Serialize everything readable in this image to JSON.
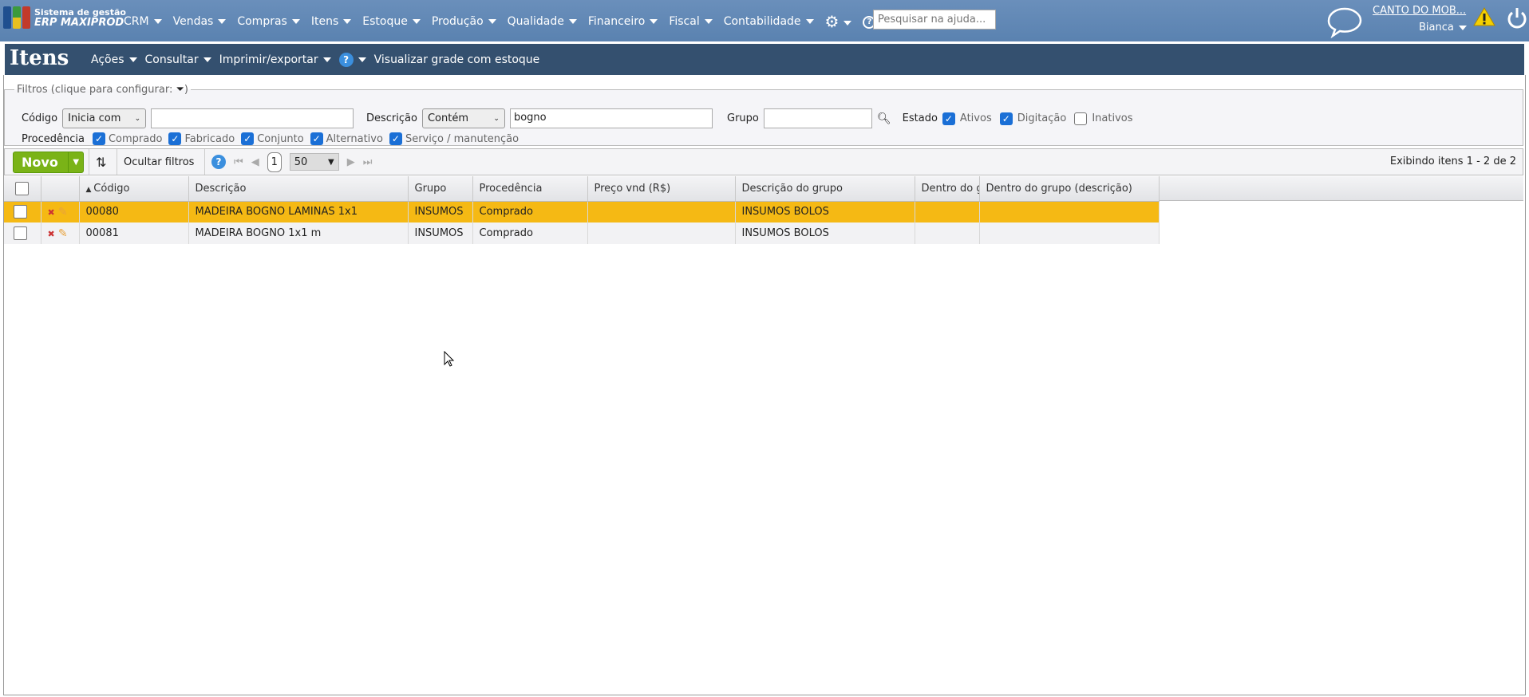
{
  "app": {
    "logo_line1": "Sistema de gestão",
    "logo_line2": "ERP MAXIPROD"
  },
  "nav": {
    "items": [
      "CRM",
      "Vendas",
      "Compras",
      "Itens",
      "Estoque",
      "Produção",
      "Qualidade",
      "Financeiro",
      "Fiscal",
      "Contabilidade"
    ],
    "help_search_placeholder": "Pesquisar na ajuda...",
    "company": "CANTO DO MOB...",
    "user": "Bianca"
  },
  "title": {
    "text": "Itens",
    "menu": [
      "Ações",
      "Consultar",
      "Imprimir/exportar"
    ],
    "grid_link": "Visualizar grade com estoque"
  },
  "filters": {
    "legend": "Filtros (clique para configurar:",
    "legend_close": ")",
    "codigo_label": "Código",
    "codigo_mode": "Inicia com",
    "codigo_value": "",
    "descricao_label": "Descrição",
    "descricao_mode": "Contém",
    "descricao_value": "bogno",
    "grupo_label": "Grupo",
    "grupo_value": "",
    "estado_label": "Estado",
    "estado": [
      {
        "label": "Ativos",
        "checked": true
      },
      {
        "label": "Digitação",
        "checked": true
      },
      {
        "label": "Inativos",
        "checked": false
      }
    ],
    "procedencia_label": "Procedência",
    "procedencia": [
      {
        "label": "Comprado",
        "checked": true
      },
      {
        "label": "Fabricado",
        "checked": true
      },
      {
        "label": "Conjunto",
        "checked": true
      },
      {
        "label": "Alternativo",
        "checked": true
      },
      {
        "label": "Serviço / manutenção",
        "checked": true
      }
    ]
  },
  "toolbar": {
    "new_label": "Novo",
    "hide_filters": "Ocultar filtros",
    "page": "1",
    "page_size": "50",
    "showing": "Exibindo itens 1 - 2 de 2"
  },
  "table": {
    "columns": [
      "Código",
      "Descrição",
      "Grupo",
      "Procedência",
      "Preço vnd (R$)",
      "Descrição do grupo",
      "Dentro do grupo",
      "Dentro do grupo (descrição)"
    ],
    "rows": [
      {
        "codigo": "00080",
        "descricao": "MADEIRA BOGNO LAMINAS 1x1",
        "grupo": "INSUMOS",
        "procedencia": "Comprado",
        "preco": "",
        "desc_grupo": "INSUMOS BOLOS",
        "dentro": "",
        "dentro_desc": ""
      },
      {
        "codigo": "00081",
        "descricao": "MADEIRA BOGNO 1x1 m",
        "grupo": "INSUMOS",
        "procedencia": "Comprado",
        "preco": "",
        "desc_grupo": "INSUMOS BOLOS",
        "dentro": "",
        "dentro_desc": ""
      }
    ]
  },
  "colors": {
    "nav": "#5f86b3",
    "title": "#34506f",
    "accent": "#7ab317",
    "selected": "#f5b914",
    "check": "#1a6fd6"
  }
}
